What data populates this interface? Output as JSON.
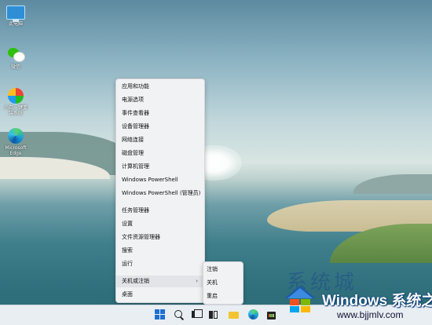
{
  "desktop": {
    "icons": [
      {
        "label": "此电脑",
        "icon": "this-pc-icon"
      },
      {
        "label": "微信",
        "icon": "wechat-icon"
      },
      {
        "label": "小白一键重装系统",
        "icon": "installer-icon"
      },
      {
        "label": "Microsoft Edge",
        "icon": "edge-icon"
      }
    ]
  },
  "context_menu": {
    "items": [
      "应用和功能",
      "电源选项",
      "事件查看器",
      "设备管理器",
      "网络连接",
      "磁盘管理",
      "计算机管理",
      "Windows PowerShell",
      "Windows PowerShell (管理员)",
      "任务管理器",
      "设置",
      "文件资源管理器",
      "搜索",
      "运行",
      "关机或注销",
      "桌面"
    ],
    "selected": "关机或注销",
    "submenu_arrow": "›"
  },
  "submenu": {
    "items": [
      "注销",
      "关机",
      "重启"
    ]
  },
  "taskbar": {
    "icons": [
      "start-icon",
      "search-icon",
      "task-view-icon",
      "widgets-icon",
      "file-explorer-icon",
      "edge-icon",
      "store-icon"
    ]
  },
  "watermark": {
    "top_text": "系统城",
    "title": "Windows 系统之家",
    "url": "www.bjjmlv.com"
  }
}
